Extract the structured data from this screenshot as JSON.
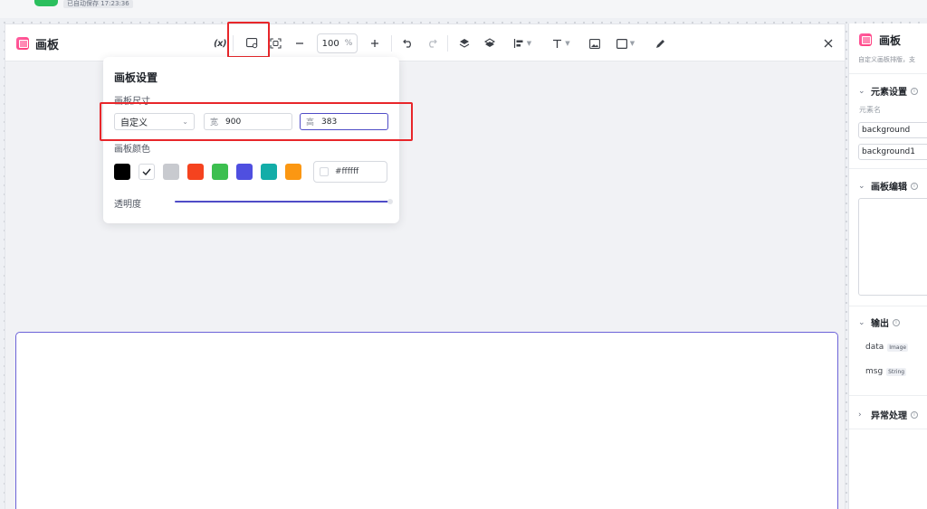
{
  "top": {
    "status": "已自动保存 17:23:36"
  },
  "editor": {
    "title": "画板",
    "toolbar": {
      "variable_label": "(x)",
      "zoom_value": "100",
      "zoom_unit": "%"
    }
  },
  "settings_popover": {
    "title": "画板设置",
    "size_label": "画板尺寸",
    "size_preset": "自定义",
    "width_prefix": "宽",
    "width_value": "900",
    "height_prefix": "高",
    "height_value": "383",
    "color_label": "画板颜色",
    "swatches": [
      "#000000",
      "#ffffff",
      "#c8cacf",
      "#f5431f",
      "#3cbf4f",
      "#4f4fe0",
      "#13ada8",
      "#fb9712"
    ],
    "selected_swatch": "#ffffff",
    "hex_value": "#ffffff",
    "opacity_label": "透明度",
    "opacity": 1.0
  },
  "right_panel": {
    "title": "画板",
    "subtitle": "自定义画板排版，支",
    "element_settings": {
      "title": "元素设置",
      "field_label": "元素名",
      "values": [
        "background",
        "background1"
      ]
    },
    "canvas_edit": {
      "title": "画板编辑"
    },
    "output": {
      "title": "输出",
      "items": [
        {
          "name": "data",
          "type": "Image"
        },
        {
          "name": "msg",
          "type": "String"
        }
      ]
    },
    "exception": {
      "title": "异常处理"
    }
  },
  "colors": {
    "accent": "#4f4cc7",
    "highlight": "#e8262a",
    "brand_pink": "#ff3b7a"
  }
}
